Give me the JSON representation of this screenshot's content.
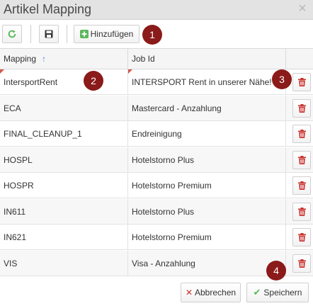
{
  "dialog": {
    "title": "Artikel Mapping",
    "close_icon": "×"
  },
  "toolbar": {
    "refresh_icon": "refresh-icon",
    "save_icon": "floppy-disk-icon",
    "add_label": "Hinzufügen"
  },
  "grid": {
    "columns": [
      "Mapping",
      "Job Id"
    ],
    "sort_indicator": "↑",
    "rows": [
      {
        "mapping": "IntersportRent",
        "job_id": "INTERSPORT Rent in unserer Nähe!"
      },
      {
        "mapping": "ECA",
        "job_id": "Mastercard - Anzahlung"
      },
      {
        "mapping": "FINAL_CLEANUP_1",
        "job_id": "Endreinigung"
      },
      {
        "mapping": "HOSPL",
        "job_id": "Hotelstorno Plus"
      },
      {
        "mapping": "HOSPR",
        "job_id": "Hotelstorno Premium"
      },
      {
        "mapping": "IN611",
        "job_id": "Hotelstorno Plus"
      },
      {
        "mapping": "IN621",
        "job_id": "Hotelstorno Premium"
      },
      {
        "mapping": "VIS",
        "job_id": "Visa - Anzahlung"
      }
    ]
  },
  "badges": [
    "1",
    "2",
    "3",
    "4"
  ],
  "footer": {
    "cancel_label": "Abbrechen",
    "save_label": "Speichern"
  },
  "colors": {
    "accent_red": "#8b1a1a",
    "delete_red": "#c9302c",
    "add_green": "#5cb85c",
    "sort_blue": "#4a90d9"
  }
}
